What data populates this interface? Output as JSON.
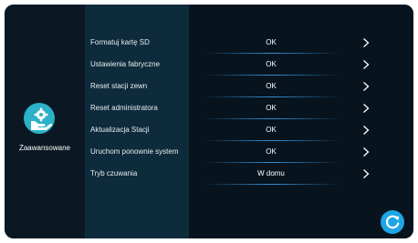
{
  "sidebar": {
    "icon": "settings-hand-icon",
    "label": "Zaawansowane"
  },
  "settings": [
    {
      "label": "Formatuj kartę SD",
      "value": "OK"
    },
    {
      "label": "Ustawienia fabryczne",
      "value": "OK"
    },
    {
      "label": "Reset stacji zewn",
      "value": "OK"
    },
    {
      "label": "Reset administratora",
      "value": "OK"
    },
    {
      "label": "Aktualizacja Stacji",
      "value": "OK"
    },
    {
      "label": "Uruchom ponownie system",
      "value": "OK"
    },
    {
      "label": "Tryb czuwania",
      "value": "W domu"
    }
  ],
  "actions": {
    "refresh_icon": "refresh-icon"
  },
  "colors": {
    "background": "#07141e",
    "panel": "#0e2b3b",
    "accent": "#2cb1c9",
    "refresh": "#1ea5e6"
  }
}
